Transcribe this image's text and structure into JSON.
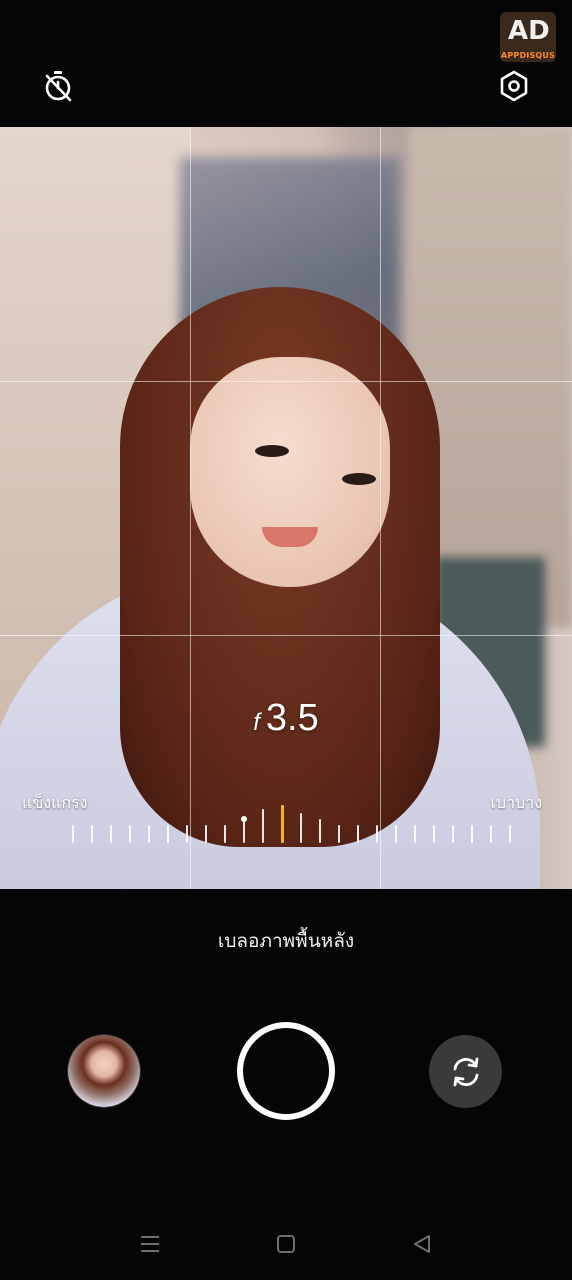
{
  "top": {
    "timer_icon": "timer-off-icon",
    "settings_icon": "settings-icon",
    "watermark_mark": "AD",
    "watermark_text": "APPDISQUS"
  },
  "viewfinder": {
    "aperture_prefix": "f",
    "aperture_value": "3.5",
    "slider_left_label": "แข็งแกร่ง",
    "slider_right_label": "เบาบาง",
    "slider_active_color": "#f3b21a"
  },
  "mode": {
    "label": "เบลอภาพพื้นหลัง"
  },
  "controls": {
    "gallery_icon": "gallery-thumbnail",
    "shutter_icon": "shutter-icon",
    "switch_camera_icon": "switch-camera-icon"
  },
  "navbar": {
    "menu_icon": "menu-icon",
    "home_icon": "home-icon",
    "back_icon": "back-icon"
  }
}
